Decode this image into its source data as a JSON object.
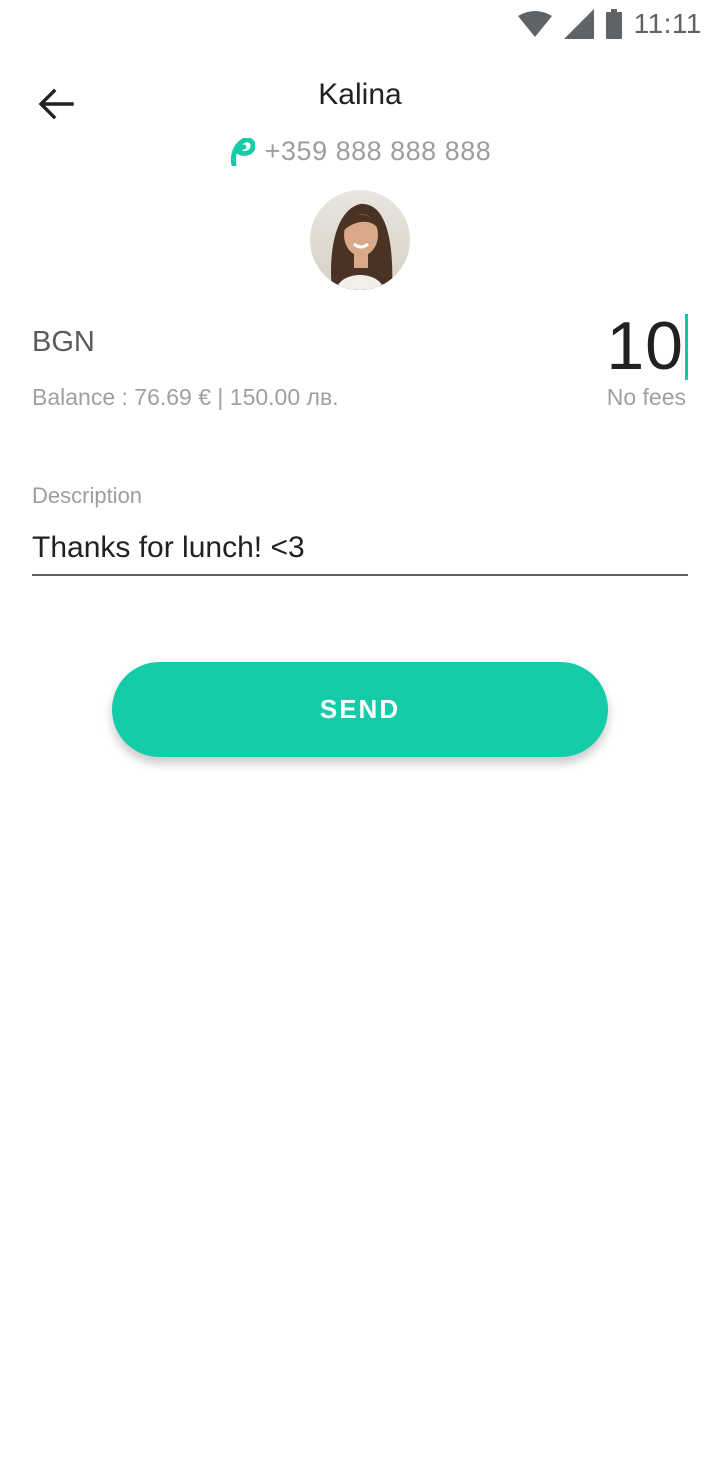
{
  "status_bar": {
    "time": "11:11",
    "icons": [
      "wifi-icon",
      "cell-signal-icon",
      "battery-icon"
    ]
  },
  "header": {
    "back_icon": "arrow-back-icon",
    "name": "Kalina",
    "phone": "+359 888 888 888",
    "phone_brand_icon": "brand-leaf-icon"
  },
  "payment": {
    "currency": "BGN",
    "balance": "Balance : 76.69 € | 150.00 лв.",
    "amount": "10",
    "fees": "No fees"
  },
  "description": {
    "label": "Description",
    "value": "Thanks for lunch! <3"
  },
  "send_button": {
    "label": "SEND"
  },
  "colors": {
    "accent": "#14cca8",
    "text": "#212121",
    "muted": "#9e9e9e"
  }
}
